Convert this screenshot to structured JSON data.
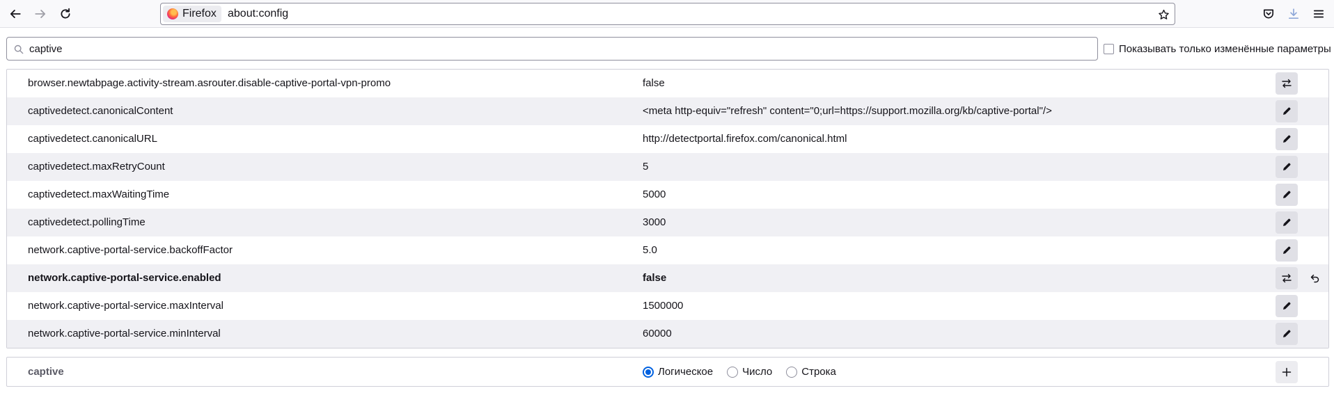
{
  "toolbar": {
    "identity_label": "Firefox",
    "url": "about:config"
  },
  "search": {
    "value": "captive",
    "only_modified_label": "Показывать только изменённые параметры"
  },
  "prefs": [
    {
      "name": "browser.newtabpage.activity-stream.asrouter.disable-captive-portal-vpn-promo",
      "value": "false",
      "action": "toggle"
    },
    {
      "name": "captivedetect.canonicalContent",
      "value": "<meta http-equiv=\"refresh\" content=\"0;url=https://support.mozilla.org/kb/captive-portal\"/>",
      "action": "edit"
    },
    {
      "name": "captivedetect.canonicalURL",
      "value": "http://detectportal.firefox.com/canonical.html",
      "action": "edit"
    },
    {
      "name": "captivedetect.maxRetryCount",
      "value": "5",
      "action": "edit"
    },
    {
      "name": "captivedetect.maxWaitingTime",
      "value": "5000",
      "action": "edit"
    },
    {
      "name": "captivedetect.pollingTime",
      "value": "3000",
      "action": "edit"
    },
    {
      "name": "network.captive-portal-service.backoffFactor",
      "value": "5.0",
      "action": "edit"
    },
    {
      "name": "network.captive-portal-service.enabled",
      "value": "false",
      "action": "toggle",
      "modified": true
    },
    {
      "name": "network.captive-portal-service.maxInterval",
      "value": "1500000",
      "action": "edit"
    },
    {
      "name": "network.captive-portal-service.minInterval",
      "value": "60000",
      "action": "edit"
    }
  ],
  "add_pref": {
    "name": "captive",
    "types": [
      "Логическое",
      "Число",
      "Строка"
    ],
    "selected_type": "Логическое"
  },
  "colors": {
    "accent": "#0061e0",
    "row_alt": "#f0f0f4"
  }
}
